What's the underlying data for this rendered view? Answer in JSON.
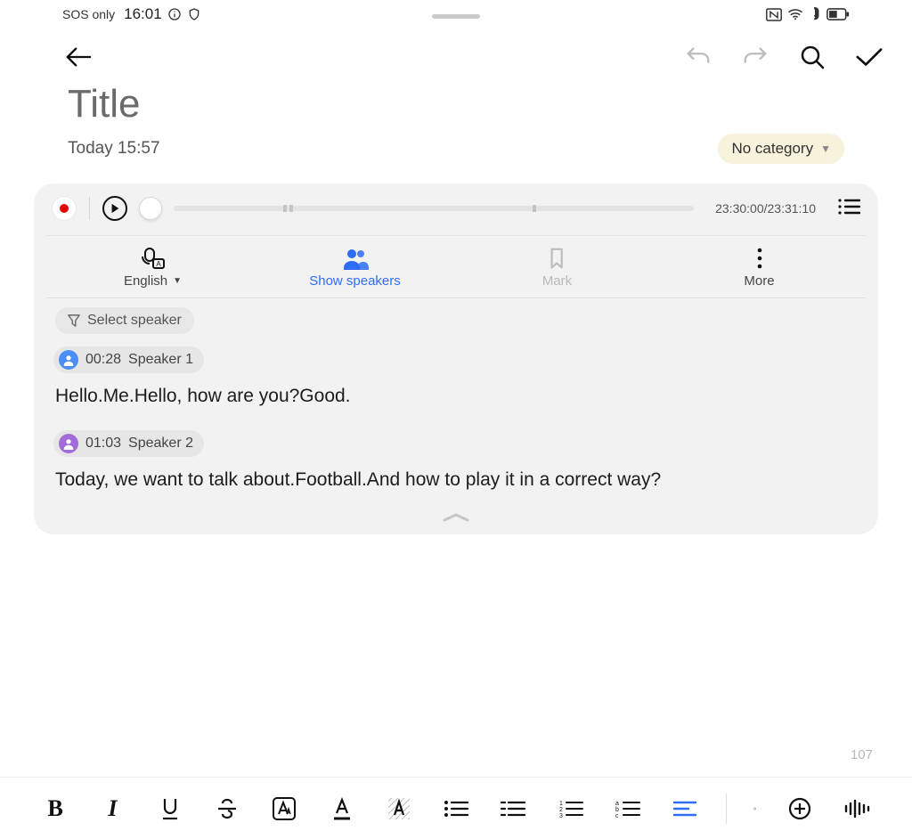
{
  "statusbar": {
    "network_text": "SOS only",
    "time": "16:01"
  },
  "header": {
    "title": "Title",
    "timestamp": "Today 15:57",
    "category_label": "No category"
  },
  "player": {
    "time_label": "23:30:00/23:31:10"
  },
  "tabs": {
    "language": "English",
    "show_speakers": "Show speakers",
    "mark": "Mark",
    "more": "More"
  },
  "filter": {
    "select_speaker": "Select speaker"
  },
  "transcript": [
    {
      "time": "00:28",
      "speaker": "Speaker 1",
      "color": "blue",
      "text": "Hello.Me.Hello, how are you?Good."
    },
    {
      "time": "01:03",
      "speaker": "Speaker 2",
      "color": "purple",
      "text": "Today, we want to talk about.Football.And how to play it in a correct way?"
    }
  ],
  "char_count": "107"
}
